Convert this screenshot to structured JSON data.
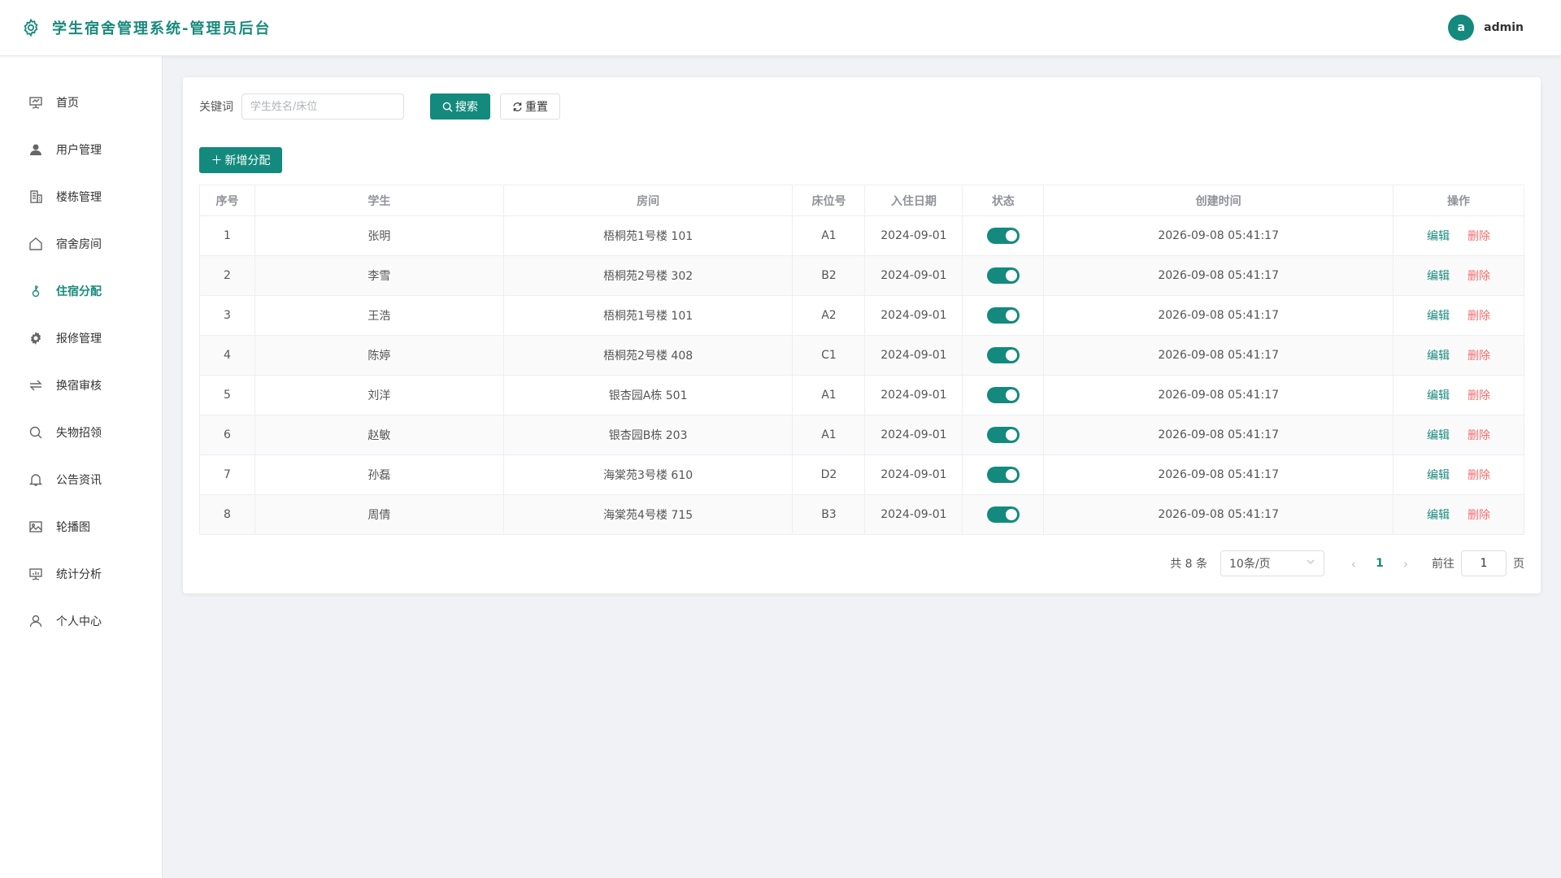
{
  "header": {
    "title": "学生宿舍管理系统-管理员后台",
    "title_icon": "gear-icon",
    "avatar_letter": "a",
    "username": "admin"
  },
  "colors": {
    "accent": "#138a7d",
    "danger": "#f56c6c"
  },
  "sidebar": {
    "items": [
      {
        "label": "首页",
        "icon": "presentation-icon"
      },
      {
        "label": "用户管理",
        "icon": "user-icon"
      },
      {
        "label": "楼栋管理",
        "icon": "building-icon"
      },
      {
        "label": "宿舍房间",
        "icon": "house-icon"
      },
      {
        "label": "住宿分配",
        "icon": "key-icon",
        "active": true
      },
      {
        "label": "报修管理",
        "icon": "gear-icon"
      },
      {
        "label": "换宿审核",
        "icon": "switch-icon"
      },
      {
        "label": "失物招领",
        "icon": "search-icon"
      },
      {
        "label": "公告资讯",
        "icon": "bell-icon"
      },
      {
        "label": "轮播图",
        "icon": "picture-icon"
      },
      {
        "label": "统计分析",
        "icon": "chart-board-icon"
      },
      {
        "label": "个人中心",
        "icon": "user-outline-icon"
      }
    ]
  },
  "search": {
    "label": "关键词",
    "placeholder": "学生姓名/床位",
    "value": "",
    "search_button": "搜索",
    "reset_button": "重置"
  },
  "toolbar": {
    "add_button": "新增分配"
  },
  "table": {
    "columns": [
      "序号",
      "学生",
      "房间",
      "床位号",
      "入住日期",
      "状态",
      "创建时间",
      "操作"
    ],
    "rows": [
      {
        "index": "1",
        "student": "张明",
        "room": "梧桐苑1号楼 101",
        "bed": "A1",
        "checkin": "2024-09-01",
        "enabled": true,
        "created": "2026-09-08 05:41:17"
      },
      {
        "index": "2",
        "student": "李雪",
        "room": "梧桐苑2号楼 302",
        "bed": "B2",
        "checkin": "2024-09-01",
        "enabled": true,
        "created": "2026-09-08 05:41:17"
      },
      {
        "index": "3",
        "student": "王浩",
        "room": "梧桐苑1号楼 101",
        "bed": "A2",
        "checkin": "2024-09-01",
        "enabled": true,
        "created": "2026-09-08 05:41:17"
      },
      {
        "index": "4",
        "student": "陈婷",
        "room": "梧桐苑2号楼 408",
        "bed": "C1",
        "checkin": "2024-09-01",
        "enabled": true,
        "created": "2026-09-08 05:41:17"
      },
      {
        "index": "5",
        "student": "刘洋",
        "room": "银杏园A栋 501",
        "bed": "A1",
        "checkin": "2024-09-01",
        "enabled": true,
        "created": "2026-09-08 05:41:17"
      },
      {
        "index": "6",
        "student": "赵敏",
        "room": "银杏园B栋 203",
        "bed": "A1",
        "checkin": "2024-09-01",
        "enabled": true,
        "created": "2026-09-08 05:41:17"
      },
      {
        "index": "7",
        "student": "孙磊",
        "room": "海棠苑3号楼 610",
        "bed": "D2",
        "checkin": "2024-09-01",
        "enabled": true,
        "created": "2026-09-08 05:41:17"
      },
      {
        "index": "8",
        "student": "周倩",
        "room": "海棠苑4号楼 715",
        "bed": "B3",
        "checkin": "2024-09-01",
        "enabled": true,
        "created": "2026-09-08 05:41:17"
      }
    ],
    "edit_label": "编辑",
    "delete_label": "删除"
  },
  "pagination": {
    "total_text": "共 8 条",
    "page_size": "10条/页",
    "current_page": "1",
    "goto_label": "前往",
    "goto_value": "1",
    "page_suffix": "页"
  }
}
